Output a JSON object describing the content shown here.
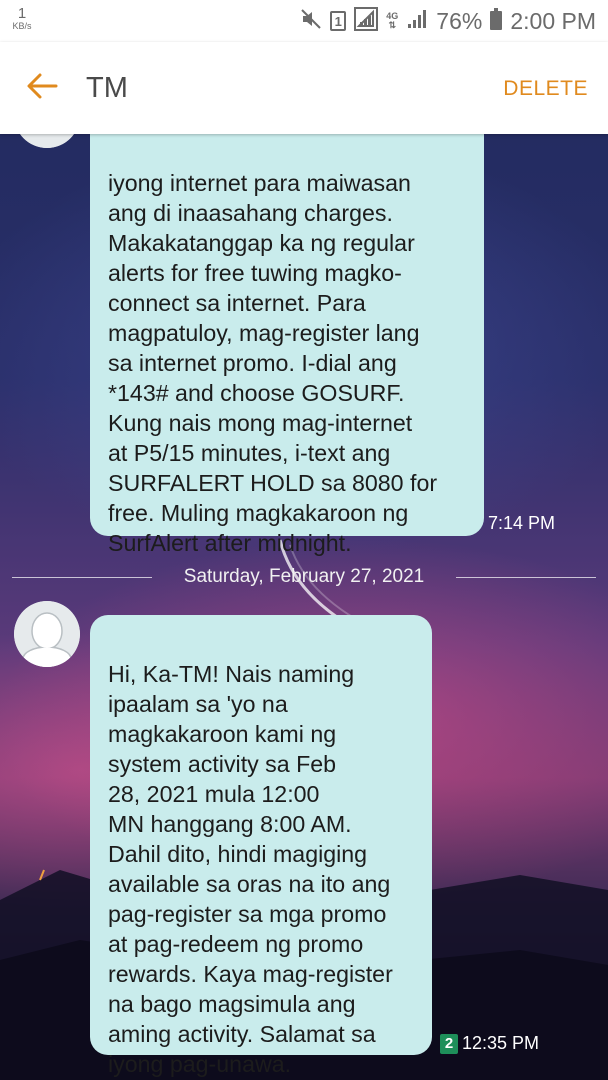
{
  "status_bar": {
    "net_speed_value": "1",
    "net_speed_unit": "KB/s",
    "sim_indicator": "1",
    "network_type": "4G",
    "battery": "76%",
    "time": "2:00 PM",
    "icons": [
      "mute-icon",
      "sim1-signal-icon",
      "sim2-signal-icon",
      "battery-icon"
    ]
  },
  "header": {
    "title": "TM",
    "delete_label": "DELETE",
    "accent_color": "#e08a1e"
  },
  "messages": [
    {
      "text": "iyong internet para maiwasan\nang di inaasahang charges.\nMakakatanggap ka ng regular\nalerts for free tuwing magko-\nconnect sa internet. Para\nmagpatuloy, mag-register lang\nsa internet promo. I-dial ang\n*143# and choose GOSURF.\nKung nais mong mag-internet\nat P5/15 minutes, i-text ang\nSURFALERT HOLD sa 8080 for\nfree. Muling magkakaroon ng\nSurfAlert after midnight.",
      "time": "7:14 PM"
    },
    {
      "text": "Hi, Ka-TM! Nais naming\nipaalam sa 'yo na\nmagkakaroon kami ng\nsystem activity sa Feb\n28, 2021 mula 12:00\nMN hanggang 8:00 AM.\nDahil dito, hindi magiging\navailable sa oras na ito ang\npag-register sa mga promo\nat pag-redeem ng promo\nrewards. Kaya mag-register\nna bago magsimula ang\naming activity. Salamat sa\niyong pag-unawa.",
      "sim": "2",
      "time": "12:35 PM"
    }
  ],
  "date_divider": "Saturday, February 27, 2021",
  "colors": {
    "bubble": "#c9ecec",
    "sim_tag": "#1e8f5a"
  }
}
